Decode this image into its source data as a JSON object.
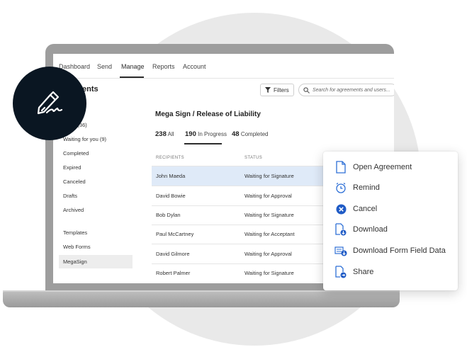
{
  "topnav": {
    "items": [
      "Dashboard",
      "Send",
      "Manage",
      "Reports",
      "Account"
    ],
    "active": "Manage"
  },
  "page": {
    "title": "greements"
  },
  "toolbar": {
    "filters_label": "Filters",
    "search_placeholder": "Search for agreements and users..."
  },
  "sidebar": {
    "items": [
      "gress (36)",
      "Waiting for you (9)",
      "Completed",
      "Expired",
      "Canceled",
      "Drafts",
      "Archived",
      "Templates",
      "Web Forms",
      "MegaSign"
    ],
    "selected": "MegaSign"
  },
  "content": {
    "title": "Mega Sign / Release of Liability",
    "tabs": [
      {
        "count": "238",
        "label": "All"
      },
      {
        "count": "190",
        "label": "In Progress"
      },
      {
        "count": "48",
        "label": "Completed"
      }
    ],
    "active_tab": "In Progress",
    "columns": [
      "RECIPIENTS",
      "STATUS"
    ],
    "rows": [
      {
        "name": "John Maeda",
        "status": "Waiting for Signature"
      },
      {
        "name": "David Bowie",
        "status": "Waiting for Approval"
      },
      {
        "name": "Bob Dylan",
        "status": "Waiting for Signature"
      },
      {
        "name": "Paul McCartney",
        "status": "Waiting for Acceptant"
      },
      {
        "name": "David Gilmore",
        "status": "Waiting for Approval"
      },
      {
        "name": "Robert Palmer",
        "status": "Waiting for Signature"
      }
    ],
    "highlighted_row": "John Maeda"
  },
  "context_menu": {
    "items": [
      {
        "label": "Open Agreement",
        "icon": "document-icon"
      },
      {
        "label": "Remind",
        "icon": "alarm-clock-icon"
      },
      {
        "label": "Cancel",
        "icon": "cancel-circle-icon"
      },
      {
        "label": "Download",
        "icon": "download-document-icon"
      },
      {
        "label": "Download Form Field Data",
        "icon": "download-data-icon"
      },
      {
        "label": "Share",
        "icon": "share-document-icon"
      }
    ]
  },
  "badge": {
    "icon": "signature-pen-icon"
  },
  "colors": {
    "accent": "#1473e6",
    "row_highlight": "#dfeaf8",
    "badge": "#0a1622",
    "laptop_frame": "#9d9d9d"
  }
}
